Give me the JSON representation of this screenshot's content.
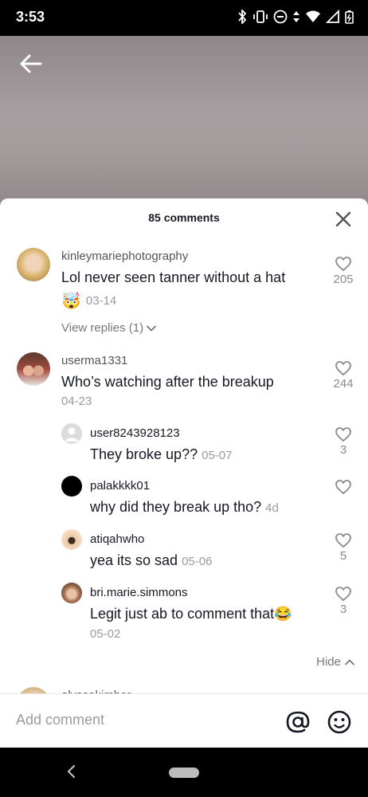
{
  "status_bar": {
    "time": "3:53"
  },
  "sheet": {
    "title": "85 comments",
    "add_comment_placeholder": "Add comment"
  },
  "comments": [
    {
      "username": "kinleymariephotography",
      "text": "Lol never seen tanner without a hat",
      "emoji": "🤯",
      "date": "03-14",
      "likes": "205",
      "view_replies": "View replies (1)"
    },
    {
      "username": "userma1331",
      "text": "Who’s watching after the breakup",
      "date": "04-23",
      "likes": "244"
    }
  ],
  "replies": [
    {
      "username": "user8243928123",
      "text": "They broke up??",
      "date": "05-07",
      "likes": "3"
    },
    {
      "username": "palakkkk01",
      "text": "why did they break up tho?",
      "date": "4d",
      "likes": ""
    },
    {
      "username": "atiqahwho",
      "text": "yea its so sad",
      "date": "05-06",
      "likes": "5"
    },
    {
      "username": "bri.marie.simmons",
      "text": "Legit just ab to comment that😂",
      "date": "05-02",
      "likes": "3"
    }
  ],
  "hide_label": "Hide",
  "partial_comment": {
    "username": "alyssakimber"
  },
  "icons": {
    "back": "arrow-left-icon",
    "close": "close-icon",
    "like": "heart-outline-icon",
    "mention": "at-sign-icon",
    "emoji": "smiley-face-icon"
  }
}
